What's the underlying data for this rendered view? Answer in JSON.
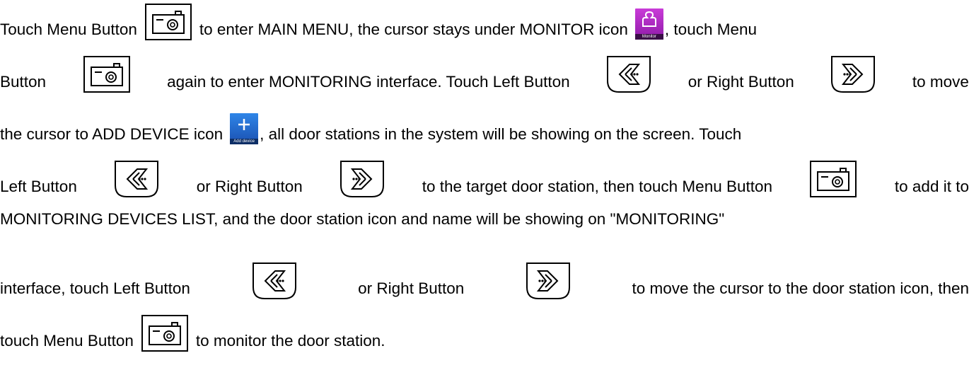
{
  "paragraph": {
    "line1": {
      "t1": "Touch Menu Button",
      "t2": "to enter MAIN MENU, the cursor stays under MONITOR icon",
      "t3": ", touch Menu"
    },
    "line2": {
      "t1": "Button",
      "t2": "again to enter MONITORING interface. Touch Left Button",
      "t3": "or Right Button",
      "t4": "to move"
    },
    "line3": {
      "t1": "the cursor to ADD DEVICE icon",
      "t2": ", all door stations in the system will be showing on the screen. Touch"
    },
    "line4": {
      "t1": "Left Button",
      "t2": "or Right Button",
      "t3": "to the target door station, then touch Menu Button",
      "t4": "to add it to"
    },
    "line5": {
      "t1": "MONITORING DEVICES LIST, and the door station icon and name will be showing on \"MONITORING\""
    },
    "line6": {
      "t1": "interface, touch Left Button",
      "t2": "or Right Button",
      "t3": "to move the cursor to the door station icon, then"
    },
    "line7": {
      "t1": "touch Menu Button",
      "t2": "to monitor the door station."
    }
  },
  "icons": {
    "menu_button": "menu-button-icon",
    "left_button": "left-button-icon",
    "right_button": "right-button-icon",
    "monitor_tile_caption": "Monitor",
    "add_device_tile_caption": "Add device"
  },
  "colors": {
    "monitor_tile": "#b02cc6",
    "add_device_tile": "#2468d0",
    "text": "#000000"
  }
}
